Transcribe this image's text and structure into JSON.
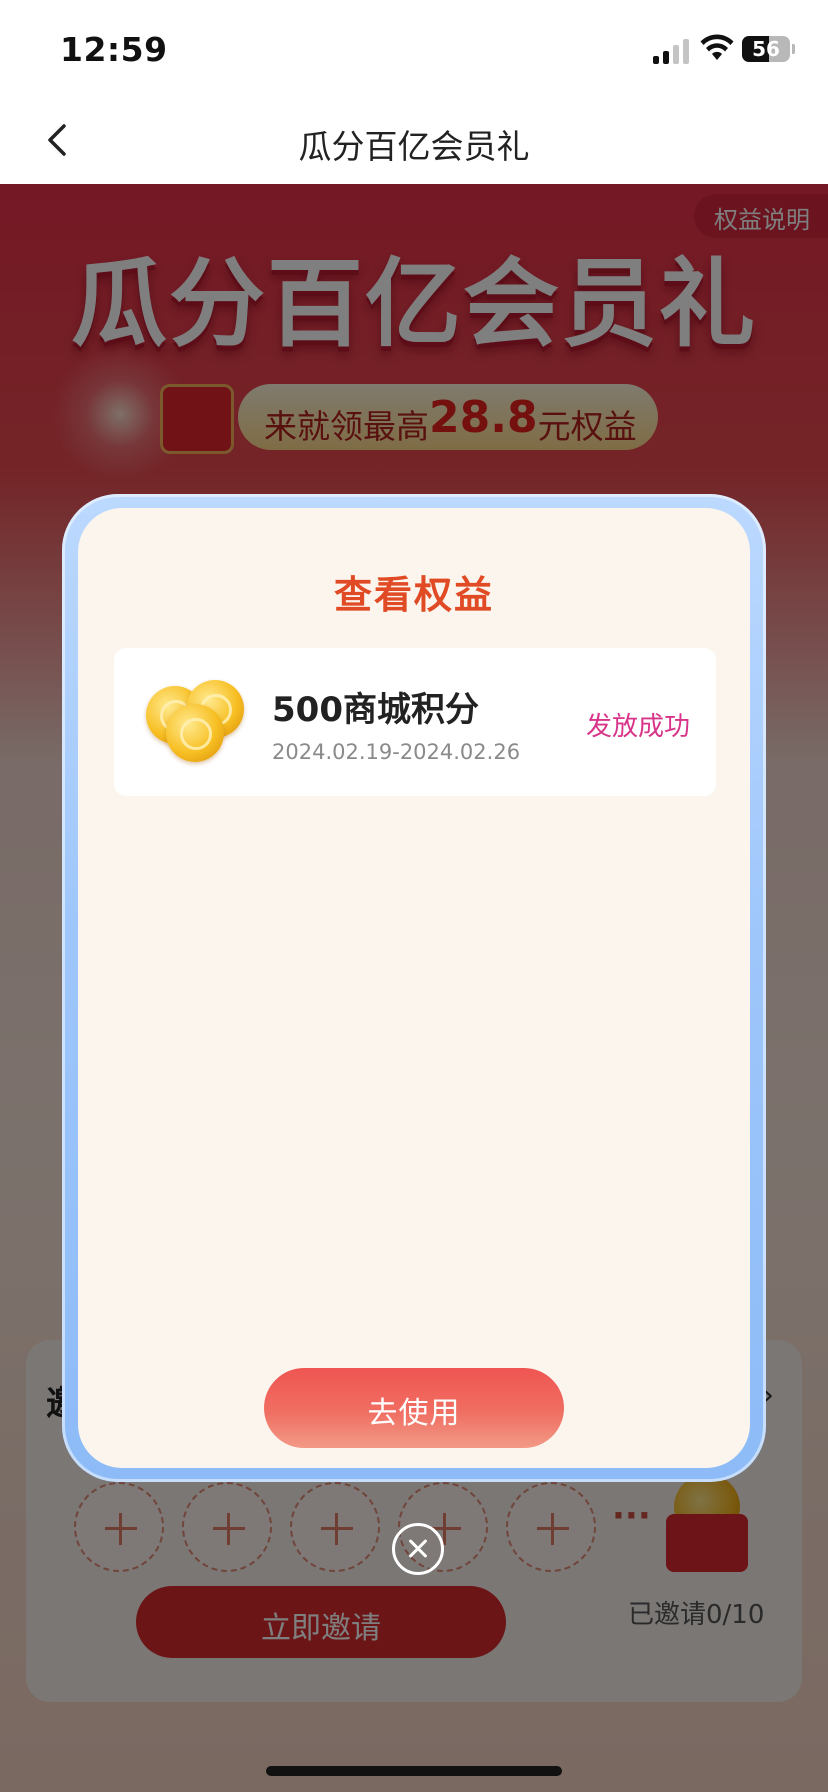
{
  "status_bar": {
    "time": "12:59",
    "battery": "56",
    "battery_level": 0.56
  },
  "nav": {
    "title": "瓜分百亿会员礼"
  },
  "page": {
    "rules_link": "权益说明",
    "hero_title": "瓜分百亿会员礼",
    "hero_sub_prefix": "来就领最高",
    "hero_sub_amount": "28.8",
    "hero_sub_suffix": "元权益",
    "invite_card_title": "邀",
    "invite_button": "立即邀请",
    "invited_count": "已邀请0/10",
    "slot_more": "···"
  },
  "modal": {
    "title": "查看权益",
    "benefits": [
      {
        "name": "500商城积分",
        "date_range": "2024.02.19-2024.02.26",
        "status": "发放成功"
      }
    ],
    "use_button": "去使用"
  },
  "colors": {
    "accent_red": "#e04a24",
    "status_pink": "#d8358a",
    "button_red": "#ef5552",
    "frame_blue": "#9ec6fb"
  }
}
